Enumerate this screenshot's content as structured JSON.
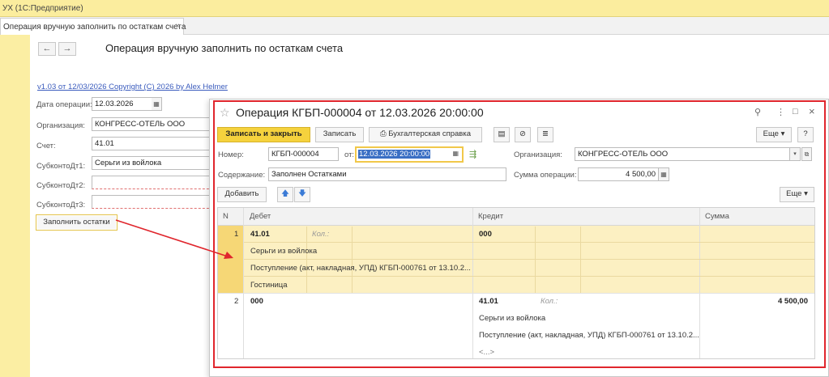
{
  "app": {
    "title": "УХ  (1С:Предприятие)"
  },
  "tabs": [
    {
      "label": "Операция вручную заполнить по остаткам счета",
      "close": "×"
    }
  ],
  "nav": {
    "back": "←",
    "forward": "→"
  },
  "page": {
    "title": "Операция вручную заполнить по остаткам счета",
    "copyright_link": "v1.03 от 12/03/2026 Copyright (C) 2026  by Alex Helmer"
  },
  "form": {
    "date_label": "Дата операции:",
    "date_value": "12.03.2026",
    "org_label": "Организация:",
    "org_value": "КОНГРЕСС-ОТЕЛЬ ООО",
    "account_label": "Счет:",
    "account_value": "41.01",
    "sub1_label": "СубконтоДт1:",
    "sub1_value": "Серьги из войлока",
    "sub2_label": "СубконтоДт2:",
    "sub2_value": "",
    "sub3_label": "СубконтоДт3:",
    "sub3_value": "",
    "fill_button": "Заполнить остатки"
  },
  "modal": {
    "title": "Операция КГБП-000004 от 12.03.2026 20:00:00",
    "star": "☆",
    "icons": {
      "link": "🔗",
      "more": "⋮",
      "maximize": "□",
      "close": "×"
    },
    "toolbar": {
      "save_close": "Записать и закрыть",
      "save": "Записать",
      "report": "Бухгалтерская справка",
      "more": "Еще",
      "help": "?"
    },
    "number_label": "Номер:",
    "number_value": "КГБП-000004",
    "from_label": "от:",
    "date_value": "12.03.2026 20:00:00",
    "org_label": "Организация:",
    "org_value": "КОНГРЕСС-ОТЕЛЬ ООО",
    "content_label": "Содержание:",
    "content_value": "Заполнен Остатками",
    "sum_label": "Сумма операции:",
    "sum_value": "4 500,00",
    "add_button": "Добавить",
    "table_more": "Еще",
    "columns": {
      "n": "N",
      "debit": "Дебет",
      "credit": "Кредит",
      "sum": "Сумма"
    },
    "rows": [
      {
        "n": "1",
        "debit_account": "41.01",
        "debit_qty": "Кол.:",
        "debit_sub1": "Серьги из войлока",
        "debit_sub2": "Поступление (акт, накладная, УПД) КГБП-000761 от 13.10.2...",
        "debit_sub3": "Гостиница",
        "credit_account": "000",
        "sum": ""
      },
      {
        "n": "2",
        "debit_account": "000",
        "credit_account": "41.01",
        "credit_qty": "Кол.:",
        "credit_sub1": "Серьги из войлока",
        "credit_sub2": "Поступление (акт, накладная, УПД) КГБП-000761 от 13.10.2...",
        "credit_sub3": "<...>",
        "sum": "4 500,00"
      }
    ]
  },
  "colors": {
    "accent_yellow": "#f5d23d",
    "frame_red": "#e0262d",
    "side_yellow": "#fbeea3"
  }
}
